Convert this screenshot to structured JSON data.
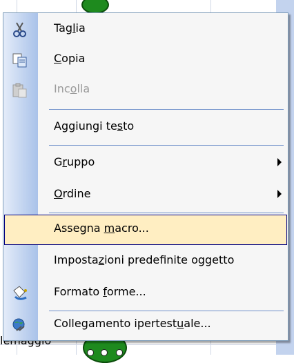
{
  "background": {
    "fragment_label": "lemaggio"
  },
  "menu": {
    "items": [
      {
        "pre": "Tag",
        "key": "l",
        "post": "ia",
        "icon": "scissors-icon",
        "enabled": true
      },
      {
        "pre": "",
        "key": "C",
        "post": "opia",
        "icon": "copy-icon",
        "enabled": true
      },
      {
        "pre": "Inc",
        "key": "o",
        "post": "lla",
        "icon": "paste-icon",
        "enabled": false
      },
      {
        "pre": "Aggiungi te",
        "key": "s",
        "post": "to",
        "icon": "",
        "enabled": true
      },
      {
        "pre": "G",
        "key": "r",
        "post": "uppo",
        "icon": "",
        "enabled": true,
        "submenu": true
      },
      {
        "pre": "",
        "key": "O",
        "post": "rdine",
        "icon": "",
        "enabled": true,
        "submenu": true
      },
      {
        "pre": "Assegna ",
        "key": "m",
        "post": "acro...",
        "icon": "",
        "enabled": true,
        "highlighted": true
      },
      {
        "pre": "Imposta",
        "key": "z",
        "post": "ioni predefinite oggetto",
        "icon": "",
        "enabled": true
      },
      {
        "pre": "Formato ",
        "key": "f",
        "post": "orme...",
        "icon": "format-shape-icon",
        "enabled": true
      },
      {
        "pre": "Collegamento ipertest",
        "key": "u",
        "post": "ale...",
        "icon": "hyperlink-icon",
        "enabled": true
      }
    ]
  },
  "colors": {
    "highlight_fill": "#ffeec2",
    "highlight_border": "#000080",
    "menu_strip": "#a9c2e9",
    "separator": "#6d8fc9"
  }
}
